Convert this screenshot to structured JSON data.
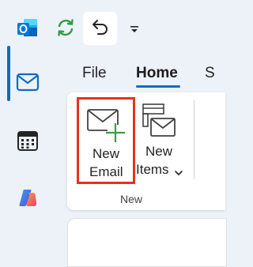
{
  "colors": {
    "background": "#edf1f8",
    "accent": "#0f6cbd",
    "highlight_box": "#e33320",
    "plus_green": "#3a9e48"
  },
  "toolbar": {
    "app_icon": "outlook-icon",
    "sync_icon": "sync-icon",
    "undo_icon": "undo-icon",
    "more_icon": "customize-toolbar-icon"
  },
  "rail": {
    "items": [
      {
        "icon": "mail-icon",
        "selected": true
      },
      {
        "icon": "calendar-icon",
        "selected": false
      },
      {
        "icon": "copilot-icon",
        "selected": false
      }
    ]
  },
  "tabs": [
    {
      "label": "File",
      "active": false
    },
    {
      "label": "Home",
      "active": true
    },
    {
      "label": "S",
      "active": false
    }
  ],
  "ribbon": {
    "new_email": {
      "line1": "New",
      "line2": "Email",
      "icon": "new-email-icon"
    },
    "new_items": {
      "line1": "New",
      "line2": "Items",
      "icon": "new-items-icon",
      "dropdown_icon": "chevron-down-icon"
    },
    "group_label": "New"
  }
}
